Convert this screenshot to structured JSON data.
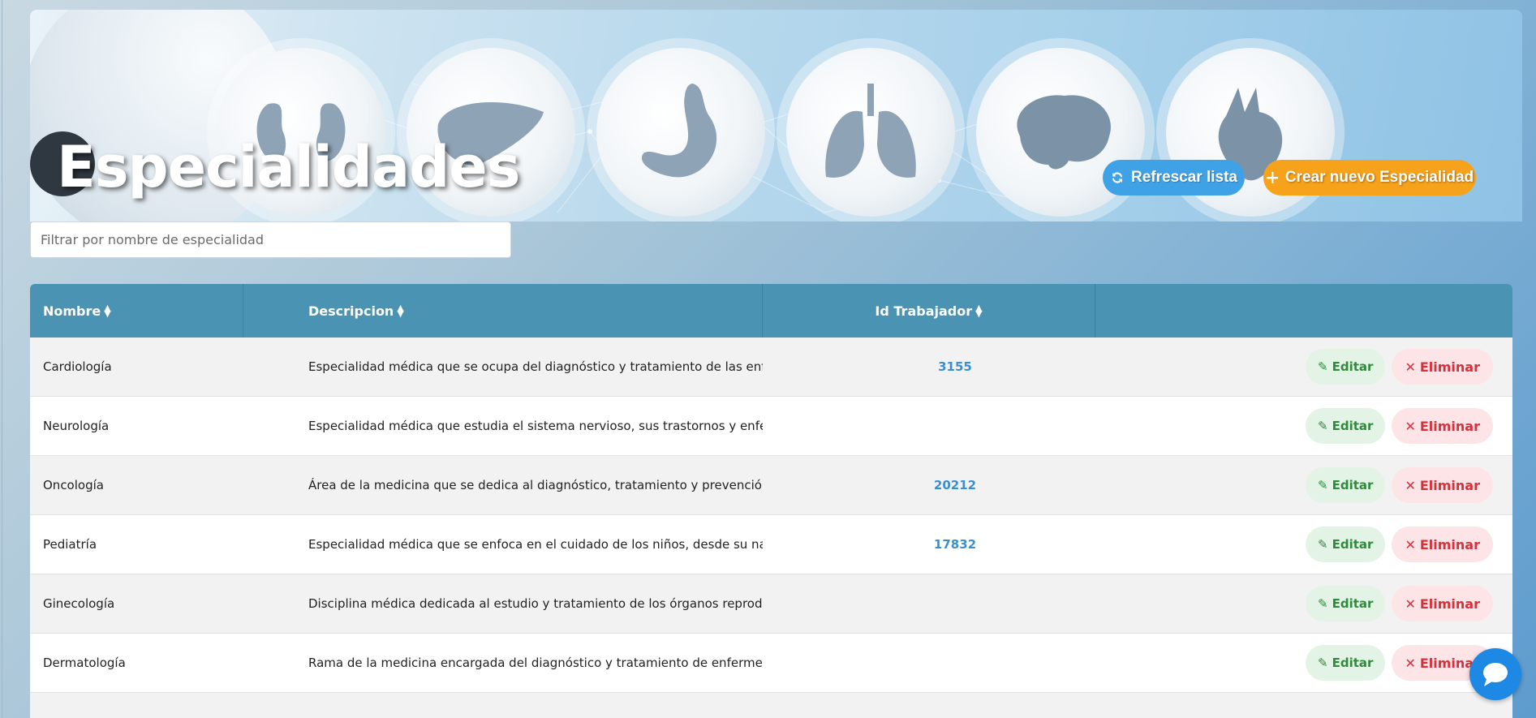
{
  "header": {
    "title": "Especialidades",
    "refresh_label": "Refrescar lista",
    "create_label": "Crear nuevo Especialidad"
  },
  "filter": {
    "placeholder": "Filtrar por nombre de especialidad",
    "value": ""
  },
  "table": {
    "columns": [
      "Nombre",
      "Descripcion",
      "Id Trabajador",
      ""
    ],
    "rows": [
      {
        "nombre": "Cardiología",
        "descripcion": "Especialidad médica que se ocupa del diagnóstico y tratamiento de las enferme...",
        "id_trabajador": "3155"
      },
      {
        "nombre": "Neurología",
        "descripcion": "Especialidad médica que estudia el sistema nervioso, sus trastornos y enfermed...",
        "id_trabajador": ""
      },
      {
        "nombre": "Oncología",
        "descripcion": "Área de la medicina que se dedica al diagnóstico, tratamiento y prevención del ...",
        "id_trabajador": "20212"
      },
      {
        "nombre": "Pediatría",
        "descripcion": "Especialidad médica que se enfoca en el cuidado de los niños, desde su nacimi...",
        "id_trabajador": "17832"
      },
      {
        "nombre": "Ginecología",
        "descripcion": "Disciplina médica dedicada al estudio y tratamiento de los órganos reproductiv...",
        "id_trabajador": ""
      },
      {
        "nombre": "Dermatología",
        "descripcion": "Rama de la medicina encargada del diagnóstico y tratamiento de enfermedade...",
        "id_trabajador": ""
      }
    ],
    "edit_label": "Editar",
    "delete_label": "Eliminar"
  },
  "colors": {
    "header_bg": "#4a93b3",
    "refresh": "#3fa2e6",
    "create": "#f7a21b",
    "id_link": "#3a8fd0",
    "edit_fg": "#2f8a3b",
    "delete_fg": "#d6303c"
  },
  "icons": {
    "refresh": "refresh-icon",
    "create": "plus-icon",
    "edit": "pencil-icon",
    "delete": "close-icon",
    "sort": "sort-icon",
    "chat": "chat-bubble-icon"
  }
}
